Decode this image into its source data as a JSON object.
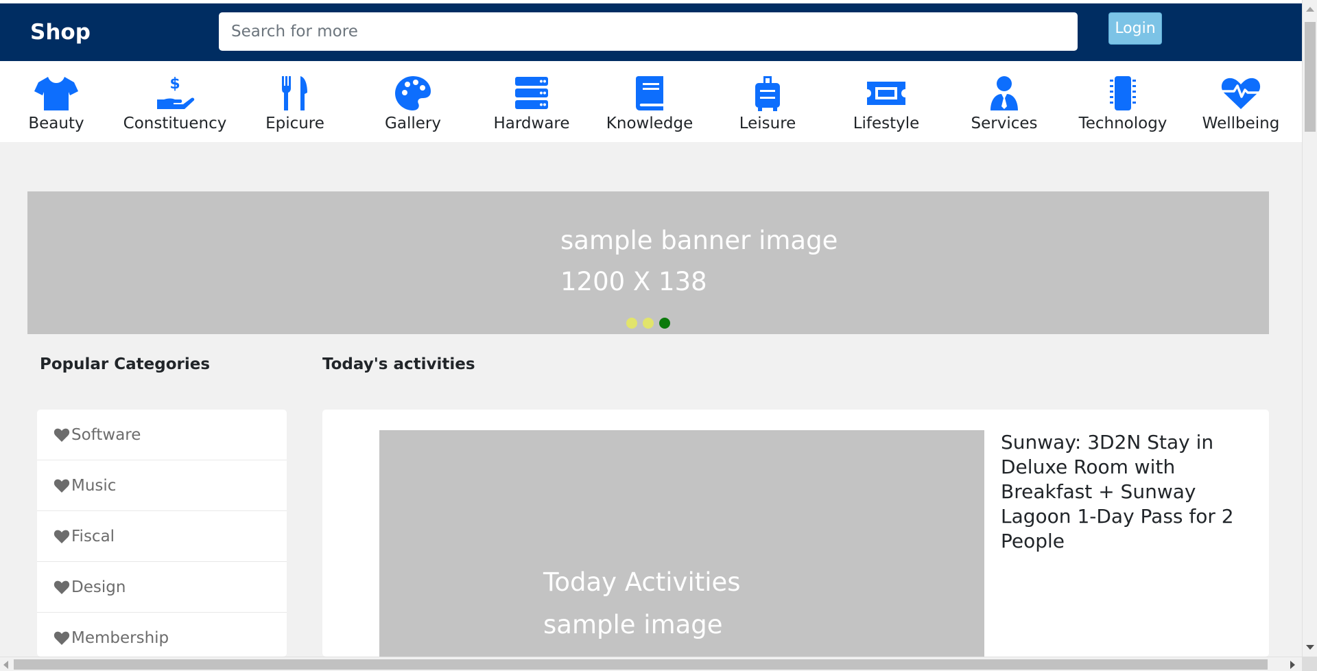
{
  "header": {
    "brand": "Shop",
    "search_placeholder": "Search for more",
    "login_label": "Login"
  },
  "categories": [
    {
      "label": "Beauty",
      "icon": "tshirt-icon"
    },
    {
      "label": "Constituency",
      "icon": "donate-hand-icon"
    },
    {
      "label": "Epicure",
      "icon": "utensils-icon"
    },
    {
      "label": "Gallery",
      "icon": "palette-icon"
    },
    {
      "label": "Hardware",
      "icon": "server-icon"
    },
    {
      "label": "Knowledge",
      "icon": "book-icon"
    },
    {
      "label": "Leisure",
      "icon": "suitcase-icon"
    },
    {
      "label": "Lifestyle",
      "icon": "ticket-icon"
    },
    {
      "label": "Services",
      "icon": "user-tie-icon"
    },
    {
      "label": "Technology",
      "icon": "microchip-icon"
    },
    {
      "label": "Wellbeing",
      "icon": "heartbeat-icon"
    }
  ],
  "banner": {
    "line1": "sample banner image",
    "line2": "1200 X 138",
    "slides": [
      {
        "color": "#e2e46b",
        "active": false
      },
      {
        "color": "#e2e46b",
        "active": false
      },
      {
        "color": "#0b7a0b",
        "active": true
      }
    ]
  },
  "popular": {
    "title": "Popular Categories",
    "items": [
      "Software",
      "Music",
      "Fiscal",
      "Design",
      "Membership"
    ]
  },
  "activities": {
    "title": "Today's activities",
    "image_line1": "Today Activities",
    "image_line2": "sample image",
    "description": "Sunway: 3D2N Stay in Deluxe Room with Breakfast + Sunway Lagoon 1-Day Pass for 2 People"
  },
  "colors": {
    "header_bg": "#002d62",
    "icon_blue": "#0d6efd",
    "login_bg": "#7cc3e6",
    "placeholder_gray": "#c3c3c3",
    "page_bg": "#f1f1f1"
  }
}
